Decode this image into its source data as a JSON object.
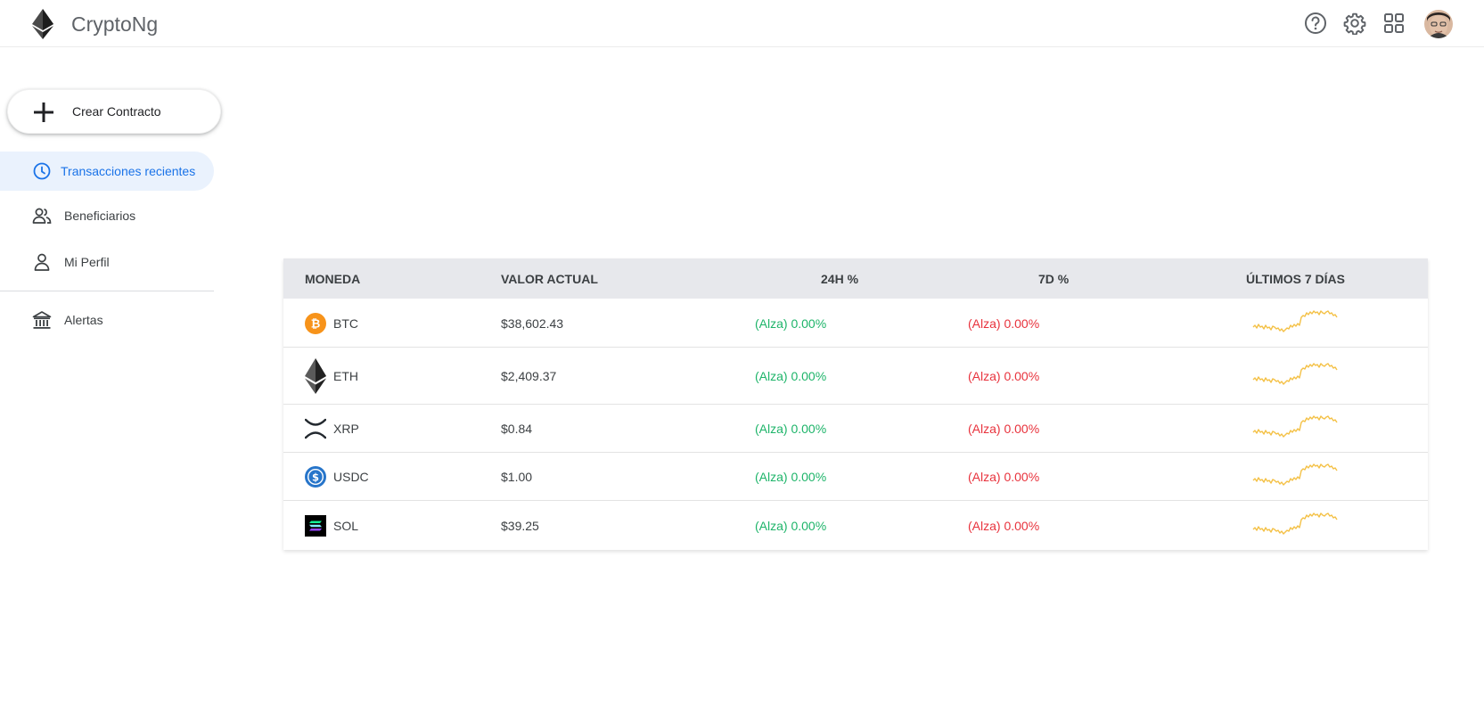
{
  "header": {
    "app_title": "CryptoNg",
    "icons": [
      "ethereum-logo-icon",
      "help-icon",
      "gear-icon",
      "apps-grid-icon",
      "avatar"
    ]
  },
  "sidebar": {
    "create_label": "Crear Contracto",
    "items": [
      {
        "label": "Transacciones recientes",
        "icon": "clock-icon",
        "active": true
      },
      {
        "label": "Beneficiarios",
        "icon": "people-icon",
        "active": false
      },
      {
        "label": "Mi Perfil",
        "icon": "person-icon",
        "active": false
      },
      {
        "label": "Alertas",
        "icon": "bank-icon",
        "active": false
      }
    ]
  },
  "table": {
    "headers": [
      "MONEDA",
      "VALOR ACTUAL",
      "24H %",
      "7D %",
      "ÚLTIMOS 7 DÍAS"
    ],
    "rows": [
      {
        "coin": "BTC",
        "value": "$38,602.43",
        "h24": "(Alza) 0.00%",
        "d7": "(Alza) 0.00%"
      },
      {
        "coin": "ETH",
        "value": "$2,409.37",
        "h24": "(Alza) 0.00%",
        "d7": "(Alza) 0.00%"
      },
      {
        "coin": "XRP",
        "value": "$0.84",
        "h24": "(Alza) 0.00%",
        "d7": "(Alza) 0.00%"
      },
      {
        "coin": "USDC",
        "value": "$1.00",
        "h24": "(Alza) 0.00%",
        "d7": "(Alza) 0.00%"
      },
      {
        "coin": "SOL",
        "value": "$39.25",
        "h24": "(Alza) 0.00%",
        "d7": "(Alza) 0.00%"
      }
    ]
  },
  "colors": {
    "accent": "#1a73e8",
    "active_bg": "#eaf2fd",
    "positive": "#1db469",
    "negative": "#e8323c",
    "sparkline": "#f4c146",
    "btc": "#f7931a",
    "usdc": "#2775ca"
  }
}
